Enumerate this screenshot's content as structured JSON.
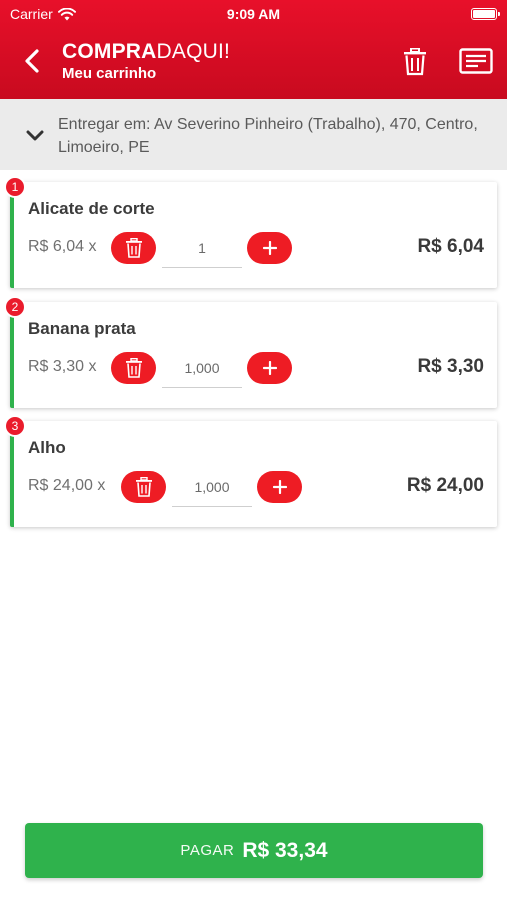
{
  "status_bar": {
    "carrier": "Carrier",
    "time": "9:09 AM"
  },
  "header": {
    "brand_bold": "COMPRA",
    "brand_light": "DAQUI!",
    "subtitle": "Meu carrinho"
  },
  "address": {
    "text": "Entregar em: Av Severino  Pinheiro (Trabalho), 470, Centro, Limoeiro, PE"
  },
  "items": [
    {
      "index": "1",
      "name": "Alicate de corte",
      "unit_price": "R$ 6,04",
      "times": "x",
      "quantity": "1",
      "total": "R$ 6,04"
    },
    {
      "index": "2",
      "name": "Banana prata",
      "unit_price": "R$ 3,30",
      "times": "x",
      "quantity": "1,000",
      "total": "R$ 3,30"
    },
    {
      "index": "3",
      "name": "Alho",
      "unit_price": "R$ 24,00",
      "times": "x",
      "quantity": "1,000",
      "total": "R$ 24,00"
    }
  ],
  "pay_button": {
    "label": "PAGAR",
    "amount": "R$ 33,34"
  },
  "colors": {
    "brand_red": "#e8102a",
    "accent_green": "#2fb24c",
    "button_red": "#ee1c24"
  }
}
